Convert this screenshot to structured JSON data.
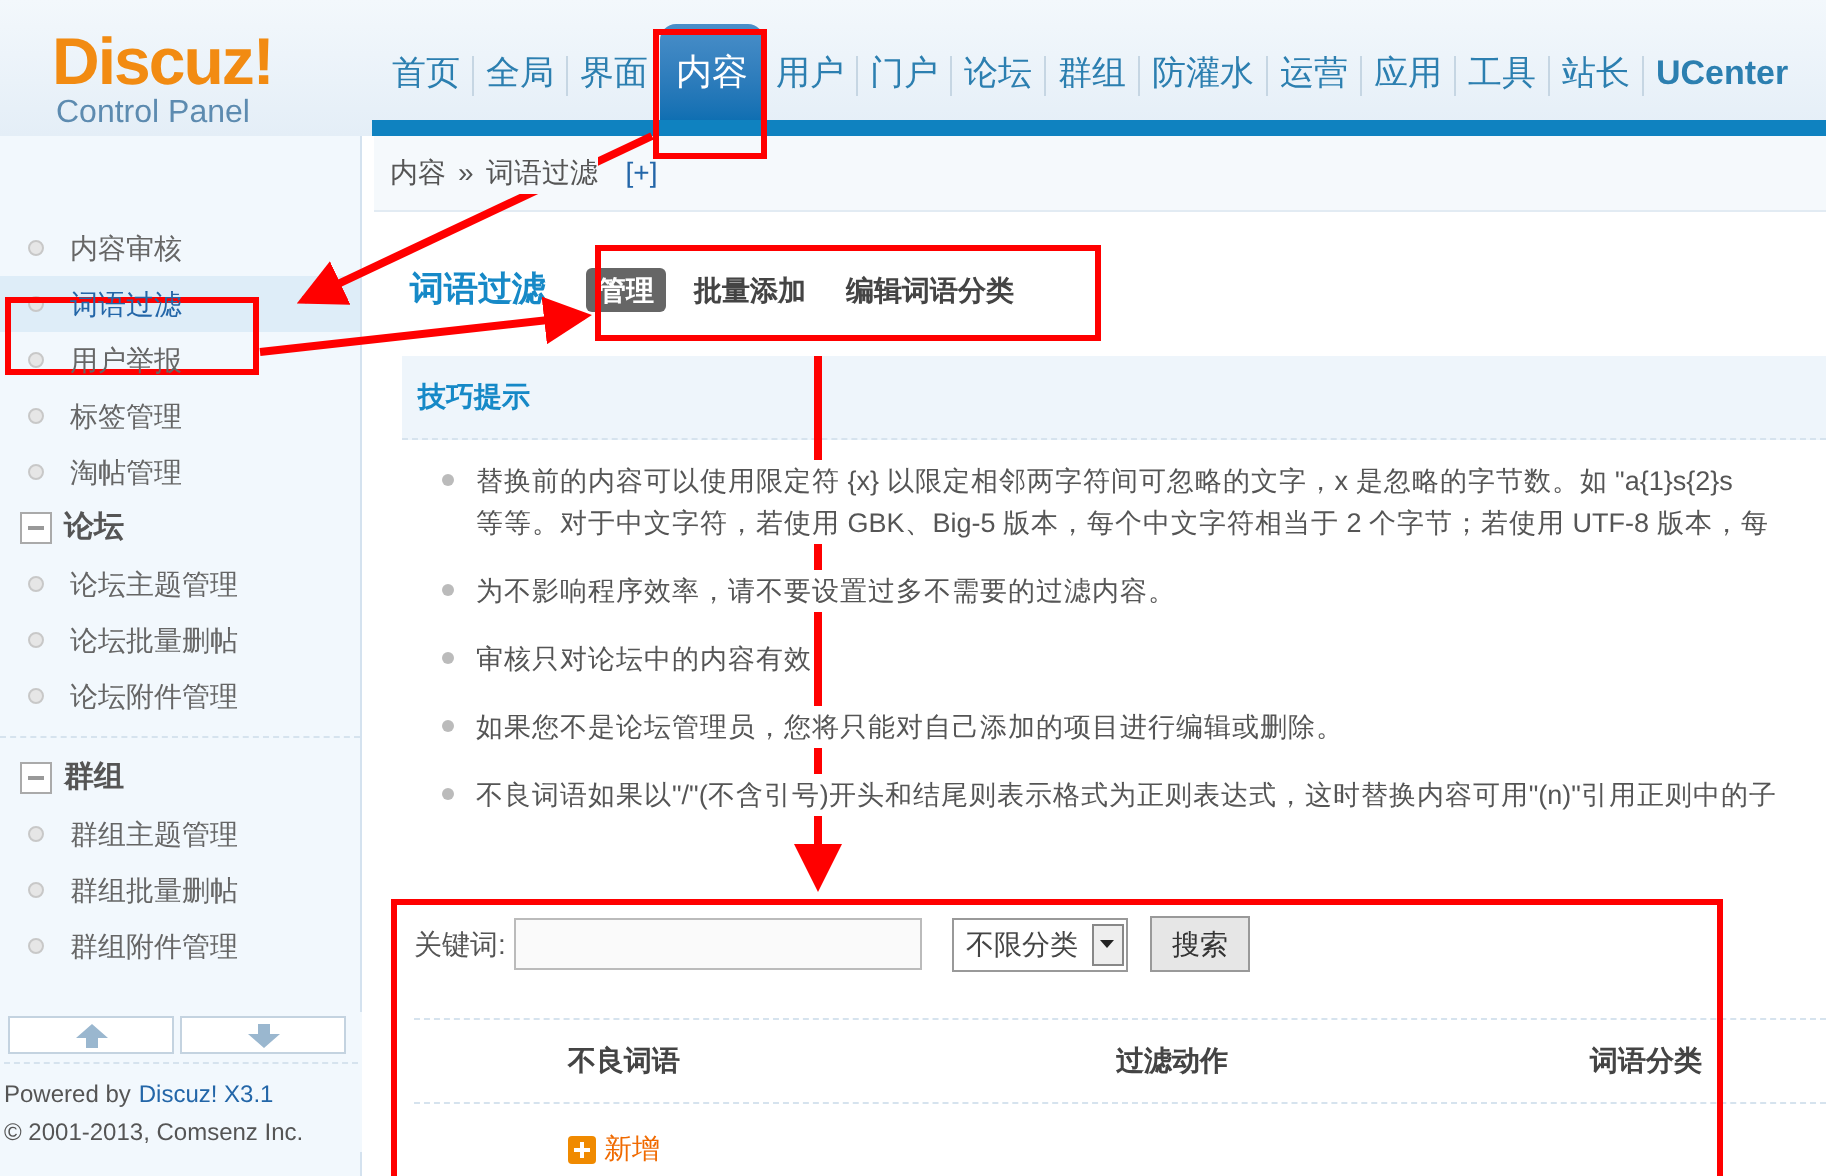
{
  "logo": {
    "name": "Discuz!",
    "subtitle": "Control Panel"
  },
  "nav": [
    {
      "label": "首页",
      "selected": false
    },
    {
      "label": "全局",
      "selected": false
    },
    {
      "label": "界面",
      "selected": false
    },
    {
      "label": "内容",
      "selected": true
    },
    {
      "label": "用户",
      "selected": false
    },
    {
      "label": "门户",
      "selected": false
    },
    {
      "label": "论坛",
      "selected": false
    },
    {
      "label": "群组",
      "selected": false
    },
    {
      "label": "防灌水",
      "selected": false
    },
    {
      "label": "运营",
      "selected": false
    },
    {
      "label": "应用",
      "selected": false
    },
    {
      "label": "工具",
      "selected": false
    },
    {
      "label": "站长",
      "selected": false
    },
    {
      "label": "UCenter",
      "selected": false
    }
  ],
  "breadcrumb": {
    "items": [
      "内容",
      "词语过滤"
    ],
    "separator": "»",
    "add": "[+]"
  },
  "sidebar": {
    "items": [
      {
        "label": "内容审核",
        "selected": false
      },
      {
        "label": "词语过滤",
        "selected": true
      },
      {
        "label": "用户举报",
        "selected": false
      },
      {
        "label": "标签管理",
        "selected": false
      },
      {
        "label": "淘帖管理",
        "selected": false
      }
    ],
    "groups": [
      {
        "title": "论坛",
        "expanded": true,
        "items": [
          {
            "label": "论坛主题管理",
            "selected": false
          },
          {
            "label": "论坛批量删帖",
            "selected": false
          },
          {
            "label": "论坛附件管理",
            "selected": false
          }
        ]
      },
      {
        "title": "群组",
        "expanded": true,
        "items": [
          {
            "label": "群组主题管理",
            "selected": false
          },
          {
            "label": "群组批量删帖",
            "selected": false
          },
          {
            "label": "群组附件管理",
            "selected": false
          }
        ]
      }
    ],
    "footer": {
      "prefix": "Powered by",
      "link": "Discuz! X3.1",
      "copyright": "© 2001-2013, Comsenz Inc."
    }
  },
  "page": {
    "title": "词语过滤",
    "tabs": [
      {
        "label": "管理",
        "selected": true
      },
      {
        "label": "批量添加",
        "selected": false
      },
      {
        "label": "编辑词语分类",
        "selected": false
      }
    ]
  },
  "tips": {
    "title": "技巧提示",
    "items": [
      [
        "替换前的内容可以使用限定符 {x} 以限定相邻两字符间可忽略的文字，x 是忽略的字节数。如 \"a{1}s{2}s",
        "等等。对于中文字符，若使用 GBK、Big-5 版本，每个中文字符相当于 2 个字节；若使用 UTF-8 版本，每"
      ],
      [
        "为不影响程序效率，请不要设置过多不需要的过滤内容。"
      ],
      [
        "审核只对论坛中的内容有效"
      ],
      [
        "如果您不是论坛管理员，您将只能对自己添加的项目进行编辑或删除。"
      ],
      [
        "不良词语如果以\"/\"(不含引号)开头和结尾则表示格式为正则表达式，这时替换内容可用\"(n)\"引用正则中的子"
      ]
    ]
  },
  "search": {
    "label": "关键词:",
    "category": "不限分类",
    "button": "搜索"
  },
  "table": {
    "columns": [
      "不良词语",
      "过滤动作",
      "词语分类"
    ],
    "add": "新增"
  }
}
